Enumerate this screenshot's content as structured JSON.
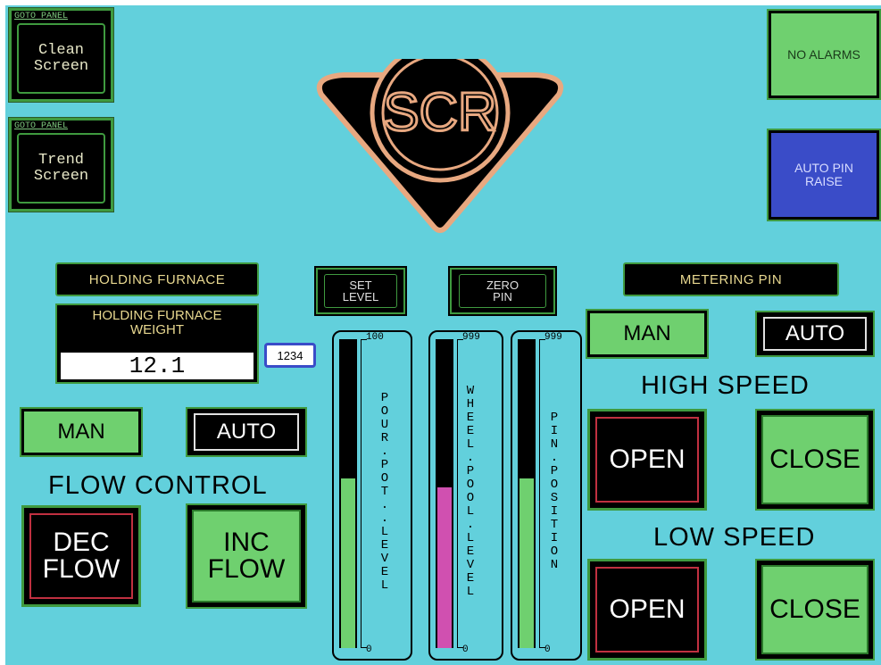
{
  "colors": {
    "screen_bg": "#62d0dc",
    "button_green": "#6fd06f",
    "border_green": "#3f9a3f",
    "auto_pin_blue": "#3a4cc8",
    "open_border_red": "#c03040",
    "pour_fill": "#6fd06f",
    "wheel_fill": "#d050b0",
    "pin_fill": "#6fd06f"
  },
  "goto_buttons": [
    {
      "caption": "GOTO PANEL",
      "line1": "Clean",
      "line2": "Screen"
    },
    {
      "caption": "GOTO PANEL",
      "line1": "Trend",
      "line2": "Screen"
    }
  ],
  "logo": {
    "text": "SCR"
  },
  "alarm_status": "NO ALARMS",
  "auto_pin_raise": {
    "line1": "AUTO PIN",
    "line2": "RAISE"
  },
  "holding_furnace": {
    "label": "HOLDING FURNACE",
    "weight_title_line1": "HOLDING FURNACE",
    "weight_title_line2": "WEIGHT",
    "weight_value": "12.1",
    "badge": "1234"
  },
  "set_level": {
    "line1": "SET",
    "line2": "LEVEL"
  },
  "zero_pin": {
    "line1": "ZERO",
    "line2": "PIN"
  },
  "metering_pin": {
    "label": "METERING PIN",
    "man": "MAN",
    "auto": "AUTO",
    "high_speed": "HIGH SPEED",
    "low_speed": "LOW SPEED",
    "open": "OPEN",
    "close": "CLOSE"
  },
  "flow_control": {
    "man": "MAN",
    "auto": "AUTO",
    "title": "FLOW CONTROL",
    "dec_line1": "DEC",
    "dec_line2": "FLOW",
    "inc_line1": "INC",
    "inc_line2": "FLOW"
  },
  "gauges": [
    {
      "id": "pour",
      "label": "POUR.POT..LEVEL",
      "max": "100",
      "min": "0",
      "fill_fraction": 0.55,
      "color_key": "pour_fill"
    },
    {
      "id": "wheel",
      "label": "WHEEL.POOL.LEVEL",
      "max": "999",
      "min": "0",
      "fill_fraction": 0.52,
      "color_key": "wheel_fill"
    },
    {
      "id": "pin",
      "label": "PIN.POSITION",
      "max": "999",
      "min": "0",
      "fill_fraction": 0.55,
      "color_key": "pin_fill"
    }
  ]
}
